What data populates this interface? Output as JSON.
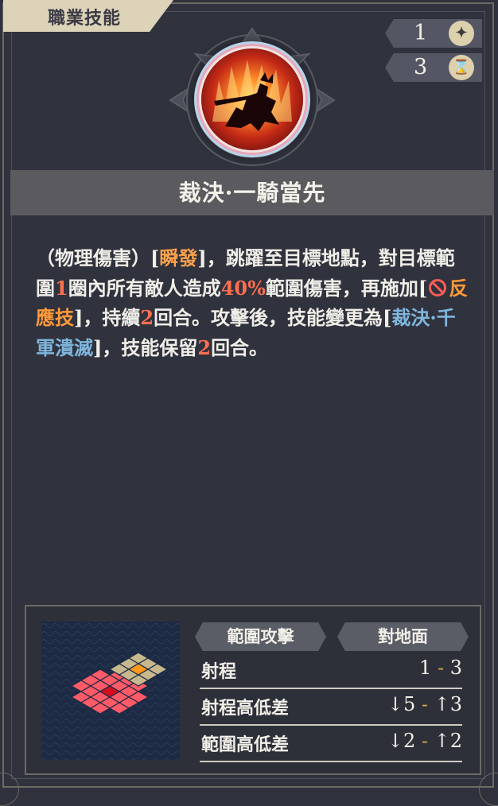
{
  "header": {
    "tab_label": "職業技能"
  },
  "stats": {
    "cost_value": "1",
    "cost_icon": "star-icon",
    "cooldown_value": "3",
    "cooldown_icon": "hourglass-icon"
  },
  "skill": {
    "icon_name": "flaming-knight-icon",
    "name": "裁決·一騎當先",
    "description": {
      "p1": "（物理傷害）[",
      "instant": "瞬發",
      "p2": "]，跳躍至目標地點，對目標範圍",
      "range_num": "1",
      "p3": "圈內所有敵人造成",
      "damage_pct": "40%",
      "p4": "範圍傷害，再施加[",
      "debuff": "反應技",
      "p5": "]，持續",
      "duration": "2",
      "p6": "回合。攻擊後，技能變更為[",
      "next_skill": "裁決·千軍潰滅",
      "p7": "]，技能保留",
      "keep": "2",
      "p8": "回合。"
    }
  },
  "panel": {
    "tag_attack_type": "範圍攻擊",
    "tag_target": "對地面",
    "rows": [
      {
        "label": "射程",
        "min": "1",
        "sep": "-",
        "max": "3"
      },
      {
        "label": "射程高低差",
        "min": "↓5",
        "sep": "-",
        "max": "↑3"
      },
      {
        "label": "範圍高低差",
        "min": "↓2",
        "sep": "-",
        "max": "↑2"
      }
    ]
  },
  "colors": {
    "background": "#2f313c",
    "tab": "#ddd3b9",
    "highlight_orange": "#ffa24a",
    "highlight_red": "#ff6f4f",
    "highlight_blue": "#7fb6dd",
    "grid_red": "#ff5a67",
    "grid_tan": "#c7b88d"
  }
}
